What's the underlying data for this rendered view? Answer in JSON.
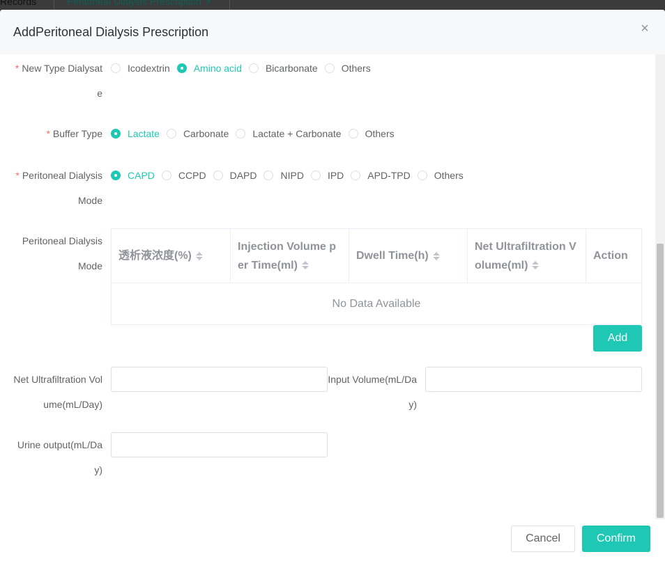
{
  "background_tabs": [
    {
      "label": "Records"
    },
    {
      "label": "Peritoneal Dialysis Prescription",
      "close": "×"
    }
  ],
  "dialog": {
    "title": "AddPeritoneal Dialysis Prescription",
    "close_glyph": "×"
  },
  "form": {
    "new_type_dialysate": {
      "required_mark": "*",
      "label_line1": "New Type Dialysat",
      "label_line2": "e",
      "options": [
        "Icodextrin",
        "Amino acid",
        "Bicarbonate",
        "Others"
      ],
      "selected": "Amino acid"
    },
    "buffer_type": {
      "required_mark": "*",
      "label": "Buffer Type",
      "options": [
        "Lactate",
        "Carbonate",
        "Lactate + Carbonate",
        "Others"
      ],
      "selected": "Lactate"
    },
    "pd_mode": {
      "required_mark": "*",
      "label_line1": "Peritoneal Dialysis",
      "label_line2": "Mode",
      "options": [
        "CAPD",
        "CCPD",
        "DAPD",
        "NIPD",
        "IPD",
        "APD-TPD",
        "Others"
      ],
      "selected": "CAPD"
    },
    "pd_mode_table": {
      "label_line1": "Peritoneal Dialysis",
      "label_line2": "Mode",
      "columns": [
        {
          "line1": "透析液浓度(%)",
          "line2": "",
          "sortable": true
        },
        {
          "line1": "Injection Volume p",
          "line2": "er Time(ml)",
          "sortable": true
        },
        {
          "line1": "Dwell Time(h)",
          "line2": "",
          "sortable": true
        },
        {
          "line1": "Net Ultrafiltration V",
          "line2": "olume(ml)",
          "sortable": true
        },
        {
          "line1": "Action",
          "line2": "",
          "sortable": false
        }
      ],
      "empty_text": "No Data Available",
      "add_label": "Add"
    },
    "net_uf_volume": {
      "label_line1": "Net Ultrafiltration Vol",
      "label_line2": "ume(mL/Day)",
      "value": "",
      "placeholder": ""
    },
    "input_volume": {
      "label_line1": "Input Volume(mL/Da",
      "label_line2": "y)",
      "value": "",
      "placeholder": ""
    },
    "urine_output": {
      "label_line1": "Urine output(mL/Da",
      "label_line2": "y)",
      "value": "",
      "placeholder": ""
    }
  },
  "footer": {
    "cancel_label": "Cancel",
    "confirm_label": "Confirm"
  },
  "colors": {
    "accent": "#1ec8b5",
    "required": "#f56c6c",
    "text": "#606266",
    "header_bg": "#f7f8fa"
  }
}
